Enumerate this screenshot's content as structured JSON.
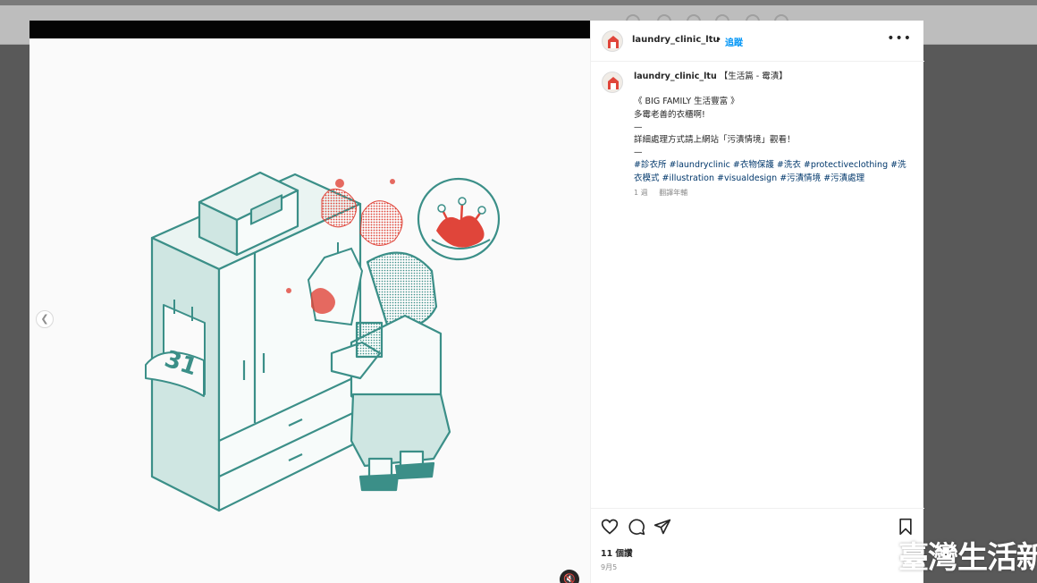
{
  "post": {
    "author": "laundry_clinic_ltu",
    "separator": "•",
    "follow_label": "追蹤",
    "more_label": "•••",
    "caption_title": "【生活篇 - 霉漬】",
    "caption_lines": [
      "《 BIG FAMILY 生活豐富 》",
      "多霉老善的衣櫃啊!",
      "—",
      "詳細處理方式請上網站「污漬情境」觀看！",
      "—"
    ],
    "hashtags": "#診衣所 #laundryclinic #衣物保護 #洗衣 #protectiveclothing #洗衣模式 #illustration #visualdesign #污漬情境 #污漬處理",
    "time_ago": "1 週",
    "translate_label": "翻譯年輔",
    "likes": "11 個讚",
    "date": "9月5"
  },
  "illustration": {
    "calendar_number": "31"
  },
  "icons": {
    "like": "heart-icon",
    "comment": "comment-icon",
    "share": "send-icon",
    "save": "bookmark-icon",
    "prev": "chevron-left-icon",
    "mute": "speaker-muted-icon"
  },
  "watermark": {
    "text": "臺灣生活新聞"
  },
  "colors": {
    "teal": "#3b8f88",
    "teal_light": "#cfe6e2",
    "stain_red": "#e0453a",
    "link_blue": "#0095f6",
    "hashtag_blue": "#00376b"
  }
}
